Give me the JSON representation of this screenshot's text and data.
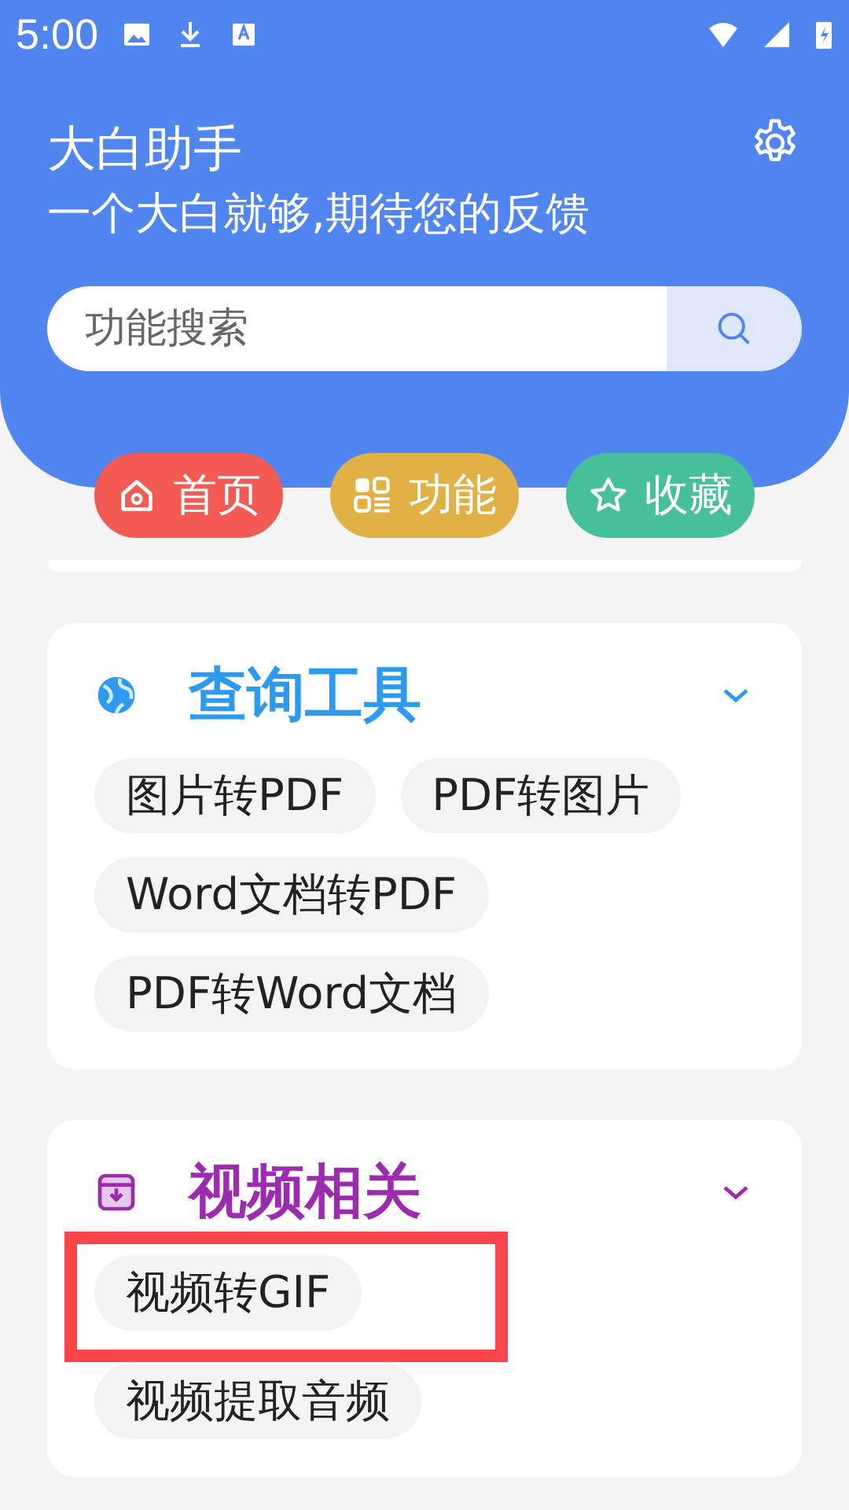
{
  "status_bar": {
    "time": "5:00"
  },
  "header": {
    "title": "大白助手",
    "subtitle": "一个大白就够,期待您的反馈"
  },
  "search": {
    "placeholder": "功能搜索"
  },
  "nav": [
    {
      "label": "首页",
      "kind": "home",
      "color": "#f25a53"
    },
    {
      "label": "功能",
      "kind": "grid",
      "color": "#e2b146"
    },
    {
      "label": "收藏",
      "kind": "star",
      "color": "#45c09a"
    }
  ],
  "sections": [
    {
      "title": "查询工具",
      "kind": "globe",
      "color": "#2b9af0",
      "expanded": true,
      "items": [
        {
          "label": "图片转PDF",
          "highlighted": false
        },
        {
          "label": "PDF转图片",
          "highlighted": false
        },
        {
          "label": "Word文档转PDF",
          "highlighted": false
        },
        {
          "label": "PDF转Word文档",
          "highlighted": false
        }
      ]
    },
    {
      "title": "视频相关",
      "kind": "box",
      "color": "#9c2bb0",
      "expanded": true,
      "items": [
        {
          "label": "视频转GIF",
          "highlighted": true
        },
        {
          "label": "视频提取音频",
          "highlighted": false
        }
      ]
    }
  ]
}
